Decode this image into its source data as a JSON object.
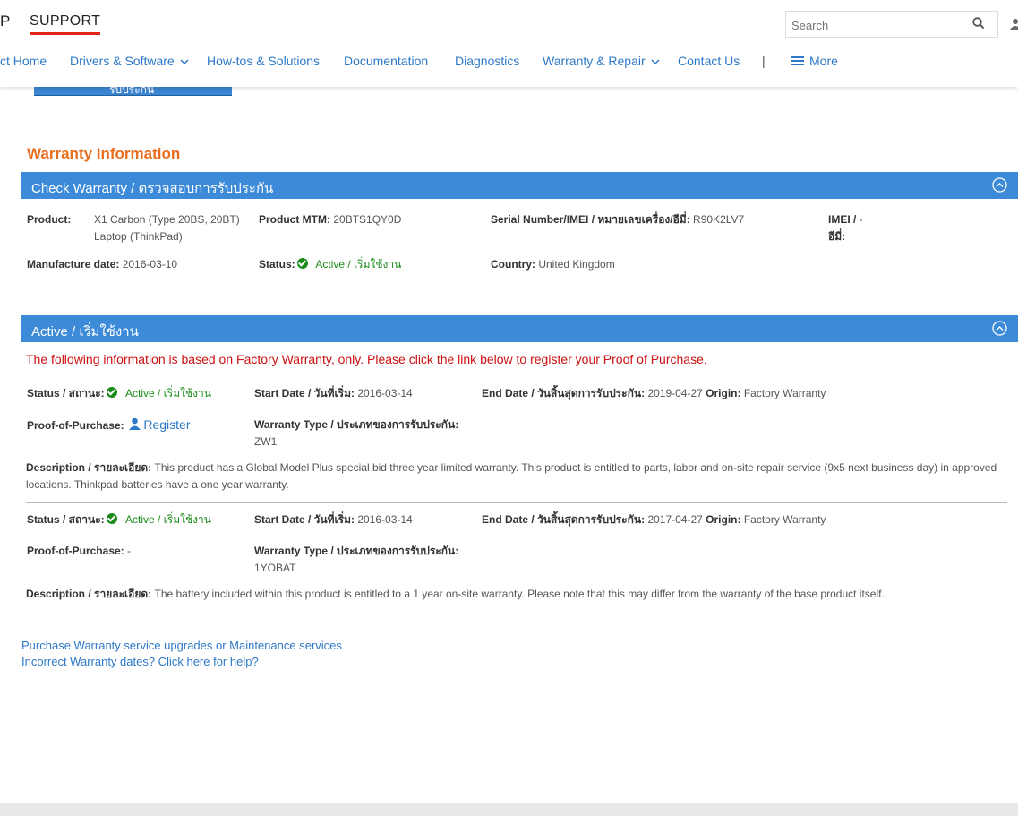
{
  "header": {
    "brand_fragment": "P",
    "support_title": "SUPPORT",
    "search_placeholder": "Search",
    "nav": [
      {
        "label": "ct Home"
      },
      {
        "label": "Drivers & Software"
      },
      {
        "label": "How-tos & Solutions"
      },
      {
        "label": "Documentation"
      },
      {
        "label": "Diagnostics"
      },
      {
        "label": "Warranty & Repair"
      },
      {
        "label": "Contact Us"
      },
      {
        "label": "More"
      }
    ],
    "separator": "|"
  },
  "partial_button_label": "รับประกัน",
  "warranty_info": {
    "title": "Warranty Information",
    "check_bar": "Check Warranty / ตรวจสอบการรับประกัน",
    "product_label": "Product:",
    "product_line1": "X1 Carbon (Type 20BS, 20BT)",
    "product_line2": "Laptop (ThinkPad)",
    "mtm_label": "Product MTM:",
    "mtm_value": "20BTS1QY0D",
    "serial_label": "Serial Number/IMEI / หมายเลขเครื่อง/อีมี่:",
    "serial_value": "R90K2LV7",
    "imei_label_1": "IMEI / ",
    "imei_value": "-",
    "imei_label_2": "อีมี่:",
    "mfg_label": "Manufacture date:",
    "mfg_value": "2016-03-10",
    "status_label": "Status:",
    "status_value": "Active / เริ่มใช้งาน",
    "country_label": "Country:",
    "country_value": "United Kingdom"
  },
  "active_section": {
    "bar_title": "Active / เริ่มใช้งาน",
    "notice": "The following information is based on Factory Warranty, only. Please click the link below to register your Proof of Purchase.",
    "entries": [
      {
        "status_label": "Status / สถานะ:",
        "status_value": "Active / เริ่มใช้งาน",
        "start_label": "Start Date / วันที่เริ่ม:",
        "start_value": "2016-03-14",
        "end_label": "End Date / วันสิ้นสุดการรับประกัน:",
        "end_value": "2019-04-27",
        "origin_label": "Origin:",
        "origin_value": "Factory Warranty",
        "pop_label": "Proof-of-Purchase:",
        "pop_value": "Register",
        "type_label": "Warranty Type / ประเภทของการรับประกัน:",
        "type_value": "ZW1",
        "desc_label": "Description / รายละเอียด:",
        "desc_value": "This product has a Global Model Plus special bid three year limited warranty. This product is entitled to parts, labor and on-site repair service (9x5 next business day) in approved locations. Thinkpad batteries have a one year warranty."
      },
      {
        "status_label": "Status / สถานะ:",
        "status_value": "Active / เริ่มใช้งาน",
        "start_label": "Start Date / วันที่เริ่ม:",
        "start_value": "2016-03-14",
        "end_label": "End Date / วันสิ้นสุดการรับประกัน:",
        "end_value": "2017-04-27",
        "origin_label": "Origin:",
        "origin_value": "Factory Warranty",
        "pop_label": "Proof-of-Purchase:",
        "pop_value": "-",
        "type_label": "Warranty Type / ประเภทของการรับประกัน:",
        "type_value": "1YOBAT",
        "desc_label": "Description / รายละเอียด:",
        "desc_value": "The battery included within this product is entitled to a 1 year on-site warranty. Please note that this may differ from the warranty of the base product itself."
      }
    ]
  },
  "links": {
    "purchase": "Purchase Warranty service upgrades or Maintenance services",
    "incorrect": "Incorrect Warranty dates? Click here for help?"
  }
}
